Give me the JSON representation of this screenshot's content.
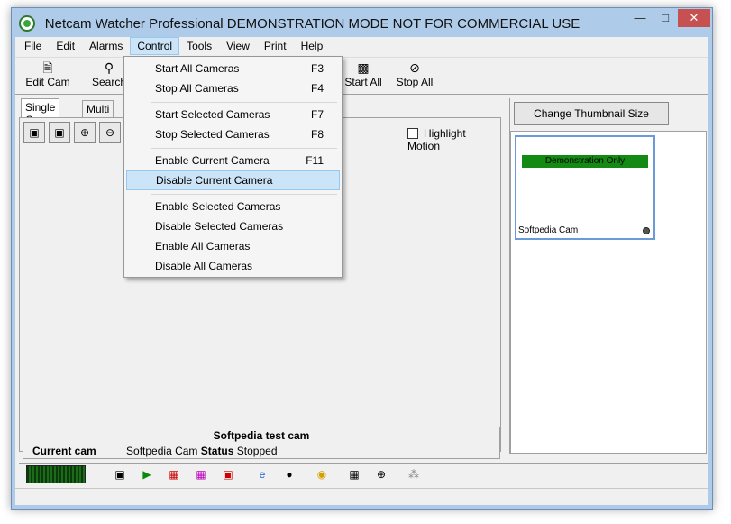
{
  "window": {
    "title": "Netcam Watcher Professional DEMONSTRATION MODE NOT FOR COMMERCIAL USE"
  },
  "menubar": [
    "File",
    "Edit",
    "Alarms",
    "Control",
    "Tools",
    "View",
    "Print",
    "Help"
  ],
  "toolbar": {
    "edit_cam": "Edit Cam",
    "search": "Search",
    "start_all": "Start All",
    "stop_all": "Stop All"
  },
  "tabs": {
    "single": "Single Cam",
    "multi": "Multi Cam"
  },
  "highlight_motion": "Highlight Motion",
  "info": {
    "camera_name": "Softpedia test cam",
    "current_label": "Current cam",
    "current_value": "Softpedia Cam",
    "status_label": "Status",
    "status_value": "Stopped"
  },
  "right": {
    "thumb_button": "Change Thumbnail Size",
    "thumb_banner": "Demonstration Only",
    "thumb_label": "Softpedia Cam"
  },
  "control_menu": {
    "groups": [
      [
        {
          "label": "Start All Cameras",
          "shortcut": "F3"
        },
        {
          "label": "Stop All Cameras",
          "shortcut": "F4"
        }
      ],
      [
        {
          "label": "Start Selected Cameras",
          "shortcut": "F7"
        },
        {
          "label": "Stop Selected Cameras",
          "shortcut": "F8"
        }
      ],
      [
        {
          "label": "Enable Current Camera",
          "shortcut": "F11"
        },
        {
          "label": "Disable Current Camera",
          "shortcut": ""
        }
      ],
      [
        {
          "label": "Enable Selected Cameras",
          "shortcut": ""
        },
        {
          "label": "Disable Selected Cameras",
          "shortcut": ""
        },
        {
          "label": "Enable All Cameras",
          "shortcut": ""
        },
        {
          "label": "Disable All Cameras",
          "shortcut": ""
        }
      ]
    ],
    "hovered": "Disable Current Camera"
  },
  "colors": {
    "title_bar": "#aecbe9",
    "close_button": "#c75050",
    "menu_highlight": "#cce4f7",
    "demo_banner": "#138a13"
  }
}
